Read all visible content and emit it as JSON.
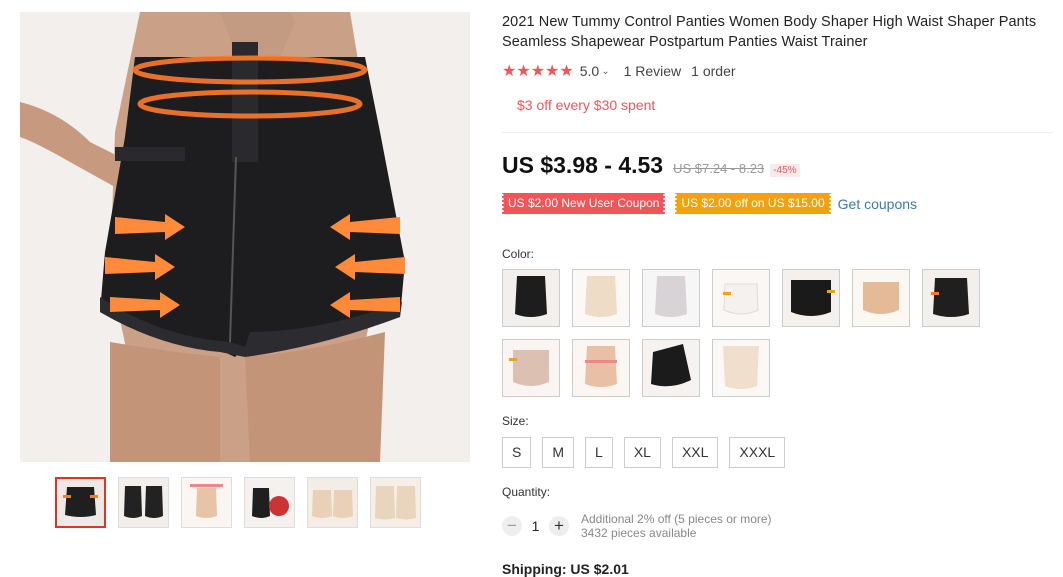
{
  "product": {
    "title": "2021 New Tummy Control Panties Women Body Shaper High Waist Shaper Pants Seamless Shapewear Postpartum Panties Waist Trainer",
    "rating_stars": "★★★★★",
    "rating_value": "5.0",
    "rating_chevron": "⌄",
    "reviews": "1 Review",
    "orders": "1 order",
    "promo": "$3 off every $30 spent",
    "price": "US $3.98 - 4.53",
    "original_price": "US $7.24 - 8.23",
    "discount": "-45%",
    "coupons": [
      "US $2.00 New User Coupon",
      "US $2.00 off on US $15.00"
    ],
    "get_coupons": "Get coupons",
    "color_label": "Color:",
    "size_label": "Size:",
    "sizes": [
      "S",
      "M",
      "L",
      "XL",
      "XXL",
      "XXXL"
    ],
    "quantity_label": "Quantity:",
    "quantity": "1",
    "qty_minus": "−",
    "qty_plus": "+",
    "qty_note_1": "Additional 2% off (5 pieces or more)",
    "qty_note_2": "3432 pieces available",
    "shipping": "Shipping: US $2.01"
  },
  "colors": {
    "accent": "#f0555a",
    "coupon_orange": "#f2a20a",
    "link": "#3b7ba6"
  }
}
